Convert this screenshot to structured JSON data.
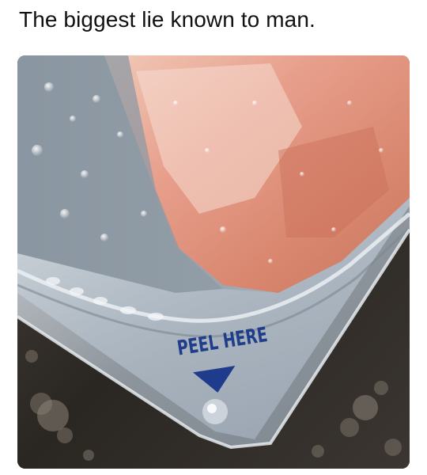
{
  "post": {
    "caption": "The biggest lie known to man."
  },
  "photo": {
    "package_label": "PEEL HERE",
    "arrow_icon": "triangle-down-arrow-icon",
    "colors": {
      "meat": "#d98f7f",
      "plastic": "#c7cfd8",
      "label_ink": "#1f3d8a",
      "counter": "#2d2a26"
    }
  }
}
